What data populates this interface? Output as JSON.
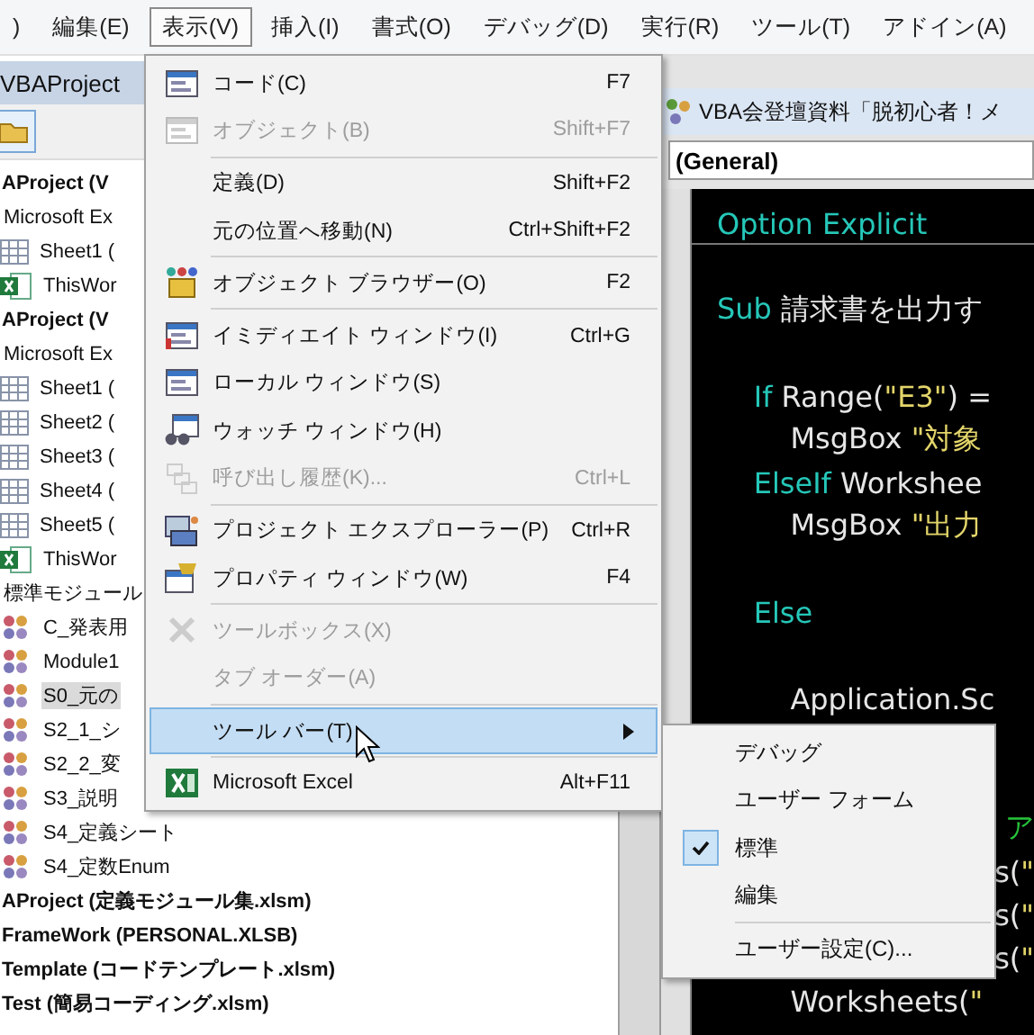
{
  "menubar": [
    {
      "label": ")",
      "selected": false
    },
    {
      "label": "編集(E)",
      "selected": false
    },
    {
      "label": "表示(V)",
      "selected": true
    },
    {
      "label": "挿入(I)",
      "selected": false
    },
    {
      "label": "書式(O)",
      "selected": false
    },
    {
      "label": "デバッグ(D)",
      "selected": false
    },
    {
      "label": "実行(R)",
      "selected": false
    },
    {
      "label": "ツール(T)",
      "selected": false
    },
    {
      "label": "アドイン(A)",
      "selected": false
    }
  ],
  "project_explorer": {
    "title": "VBAProject",
    "tree": [
      {
        "kind": "project",
        "label": "AProject (V",
        "selected": false,
        "children": [
          {
            "kind": "folder",
            "label": "Microsoft Ex",
            "selected": false,
            "children": [
              {
                "kind": "sheet",
                "label": "Sheet1 (",
                "selected": false
              },
              {
                "kind": "workbook",
                "label": "ThisWor",
                "selected": false
              }
            ]
          }
        ]
      },
      {
        "kind": "project",
        "label": "AProject (V",
        "selected": false,
        "children": [
          {
            "kind": "folder",
            "label": "Microsoft Ex",
            "selected": false,
            "children": [
              {
                "kind": "sheet",
                "label": "Sheet1 (",
                "selected": false
              },
              {
                "kind": "sheet",
                "label": "Sheet2 (",
                "selected": false
              },
              {
                "kind": "sheet",
                "label": "Sheet3 (",
                "selected": false
              },
              {
                "kind": "sheet",
                "label": "Sheet4 (",
                "selected": false
              },
              {
                "kind": "sheet",
                "label": "Sheet5 (",
                "selected": false
              },
              {
                "kind": "workbook",
                "label": "ThisWor",
                "selected": false
              }
            ]
          },
          {
            "kind": "folder",
            "label": "標準モジュール",
            "selected": false,
            "children": [
              {
                "kind": "module",
                "label": "C_発表用",
                "selected": false
              },
              {
                "kind": "module",
                "label": "Module1",
                "selected": false
              },
              {
                "kind": "module",
                "label": "S0_元の",
                "selected": true
              },
              {
                "kind": "module",
                "label": "S2_1_シ",
                "selected": false
              },
              {
                "kind": "module",
                "label": "S2_2_変",
                "selected": false
              },
              {
                "kind": "module",
                "label": "S3_説明",
                "selected": false
              },
              {
                "kind": "module",
                "label": "S4_定義シート",
                "selected": false
              },
              {
                "kind": "module",
                "label": "S4_定数Enum",
                "selected": false
              }
            ]
          }
        ]
      },
      {
        "kind": "project",
        "label": "AProject (定義モジュール集.xlsm)",
        "selected": false
      },
      {
        "kind": "project",
        "label": "FrameWork (PERSONAL.XLSB)",
        "selected": false
      },
      {
        "kind": "project",
        "label": "Template (コードテンプレート.xlsm)",
        "selected": false
      },
      {
        "kind": "project",
        "label": "Test (簡易コーディング.xlsm)",
        "selected": false
      }
    ]
  },
  "code_window": {
    "title": "VBA会登壇資料「脱初心者！メ",
    "object_box": "(General)",
    "lines": [
      {
        "kind": "code",
        "procedure_separator": true,
        "tokens": [
          {
            "kind": "keyword",
            "text": "Option Explicit"
          }
        ]
      },
      {
        "kind": "blank"
      },
      {
        "kind": "code",
        "tokens": [
          {
            "kind": "keyword",
            "text": "Sub"
          },
          {
            "kind": "plain",
            "text": " 請求書を出力す"
          }
        ]
      },
      {
        "kind": "blank"
      },
      {
        "kind": "code",
        "tokens": [
          {
            "kind": "keyword",
            "text": "    If"
          },
          {
            "kind": "plain",
            "text": " Range("
          },
          {
            "kind": "string",
            "text": "\"E3\""
          },
          {
            "kind": "plain",
            "text": ") ="
          }
        ]
      },
      {
        "kind": "code",
        "tokens": [
          {
            "kind": "plain",
            "text": "        MsgBox "
          },
          {
            "kind": "string",
            "text": "\"対象"
          }
        ]
      },
      {
        "kind": "code",
        "tokens": [
          {
            "kind": "keyword",
            "text": "    ElseIf"
          },
          {
            "kind": "plain",
            "text": " Workshee"
          }
        ]
      },
      {
        "kind": "code",
        "tokens": [
          {
            "kind": "plain",
            "text": "        MsgBox "
          },
          {
            "kind": "string",
            "text": "\"出力"
          }
        ]
      },
      {
        "kind": "blank"
      },
      {
        "kind": "code",
        "tokens": [
          {
            "kind": "keyword",
            "text": "    Else"
          }
        ]
      },
      {
        "kind": "blank"
      },
      {
        "kind": "code",
        "tokens": [
          {
            "kind": "plain",
            "text": "        Application.Sc"
          }
        ]
      },
      {
        "kind": "blank"
      },
      {
        "kind": "blank"
      },
      {
        "kind": "partial",
        "tokens": [
          {
            "kind": "comment",
            "text": "ア"
          }
        ]
      },
      {
        "kind": "partial",
        "tokens": [
          {
            "kind": "plain",
            "text": "s("
          },
          {
            "kind": "string",
            "text": "\""
          }
        ]
      },
      {
        "kind": "partial",
        "tokens": [
          {
            "kind": "plain",
            "text": "s("
          },
          {
            "kind": "string",
            "text": "\""
          }
        ]
      },
      {
        "kind": "partial",
        "tokens": [
          {
            "kind": "plain",
            "text": "s("
          },
          {
            "kind": "string",
            "text": "\""
          }
        ]
      },
      {
        "kind": "code",
        "tokens": [
          {
            "kind": "plain",
            "text": "        Worksheets("
          },
          {
            "kind": "string",
            "text": "\""
          }
        ]
      }
    ]
  },
  "view_menu": {
    "items": [
      {
        "kind": "command",
        "label": "コード(C)",
        "shortcut": "F7",
        "disabled": false
      },
      {
        "kind": "command",
        "label": "オブジェクト(B)",
        "shortcut": "Shift+F7",
        "disabled": true
      },
      {
        "kind": "separator"
      },
      {
        "kind": "command",
        "label": "定義(D)",
        "shortcut": "Shift+F2",
        "disabled": false
      },
      {
        "kind": "command",
        "label": "元の位置へ移動(N)",
        "shortcut": "Ctrl+Shift+F2",
        "disabled": false
      },
      {
        "kind": "separator"
      },
      {
        "kind": "command",
        "label": "オブジェクト ブラウザー(O)",
        "shortcut": "F2",
        "disabled": false
      },
      {
        "kind": "separator"
      },
      {
        "kind": "command",
        "label": "イミディエイト ウィンドウ(I)",
        "shortcut": "Ctrl+G",
        "disabled": false
      },
      {
        "kind": "command",
        "label": "ローカル ウィンドウ(S)",
        "disabled": false
      },
      {
        "kind": "command",
        "label": "ウォッチ ウィンドウ(H)",
        "disabled": false
      },
      {
        "kind": "command",
        "label": "呼び出し履歴(K)...",
        "shortcut": "Ctrl+L",
        "disabled": true
      },
      {
        "kind": "separator"
      },
      {
        "kind": "command",
        "label": "プロジェクト エクスプローラー(P)",
        "shortcut": "Ctrl+R",
        "disabled": false
      },
      {
        "kind": "command",
        "label": "プロパティ ウィンドウ(W)",
        "shortcut": "F4",
        "disabled": false
      },
      {
        "kind": "separator"
      },
      {
        "kind": "command",
        "label": "ツールボックス(X)",
        "disabled": true
      },
      {
        "kind": "command",
        "label": "タブ オーダー(A)",
        "disabled": true
      },
      {
        "kind": "separator"
      },
      {
        "kind": "submenu",
        "label": "ツール バー(T)",
        "disabled": false,
        "highlighted": true
      },
      {
        "kind": "separator"
      },
      {
        "kind": "command",
        "label": "Microsoft Excel",
        "shortcut": "Alt+F11",
        "disabled": false
      }
    ]
  },
  "toolbar_submenu": {
    "items": [
      {
        "kind": "command",
        "label": "デバッグ",
        "checked": false
      },
      {
        "kind": "command",
        "label": "ユーザー フォーム",
        "checked": false
      },
      {
        "kind": "command",
        "label": "標準",
        "checked": true
      },
      {
        "kind": "command",
        "label": "編集",
        "checked": false
      },
      {
        "kind": "separator"
      },
      {
        "kind": "command",
        "label": "ユーザー設定(C)...",
        "checked": false
      }
    ]
  }
}
